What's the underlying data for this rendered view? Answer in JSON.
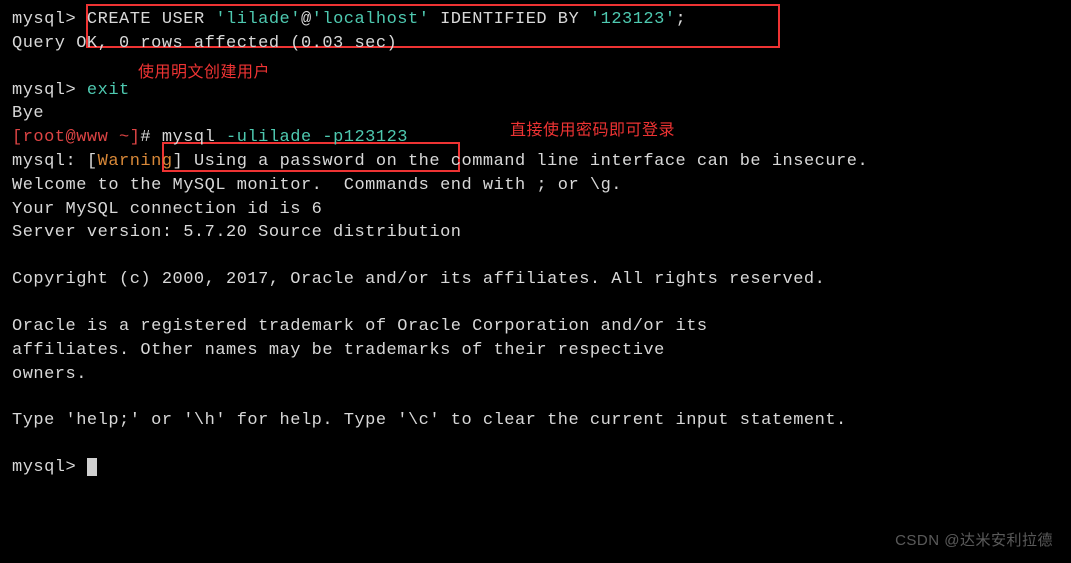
{
  "lines": {
    "l1_prompt": "mysql> ",
    "l1_cmd1": "CREATE USER ",
    "l1_user": "'lilade'",
    "l1_at": "@",
    "l1_host": "'localhost'",
    "l1_cmd2": " IDENTIFIED BY ",
    "l1_pass": "'123123'",
    "l1_semi": ";",
    "l2": "Query OK, 0 rows affected (0.03 sec)",
    "l4_prompt": "mysql> ",
    "l4_cmd": "exit",
    "l5": "Bye",
    "l6_a": "[root@www ~]",
    "l6_b": "# ",
    "l6_c": "mysql ",
    "l6_d": "-ulilade -p123123",
    "l7_a": "mysql: [",
    "l7_b": "Warning",
    "l7_c": "] Using a password on the command line interface can be insecure.",
    "l8": "Welcome to the MySQL monitor.  Commands end with ; or \\g.",
    "l9": "Your MySQL connection id is 6",
    "l10": "Server version: 5.7.20 Source distribution",
    "l12": "Copyright (c) 2000, 2017, Oracle and/or its affiliates. All rights reserved.",
    "l14": "Oracle is a registered trademark of Oracle Corporation and/or its",
    "l15": "affiliates. Other names may be trademarks of their respective",
    "l16": "owners.",
    "l18": "Type 'help;' or '\\h' for help. Type '\\c' to clear the current input statement.",
    "l20_prompt": "mysql> "
  },
  "annotations": {
    "a1": "使用明文创建用户",
    "a2": "直接使用密码即可登录"
  },
  "watermark": "CSDN @达米安利拉德"
}
